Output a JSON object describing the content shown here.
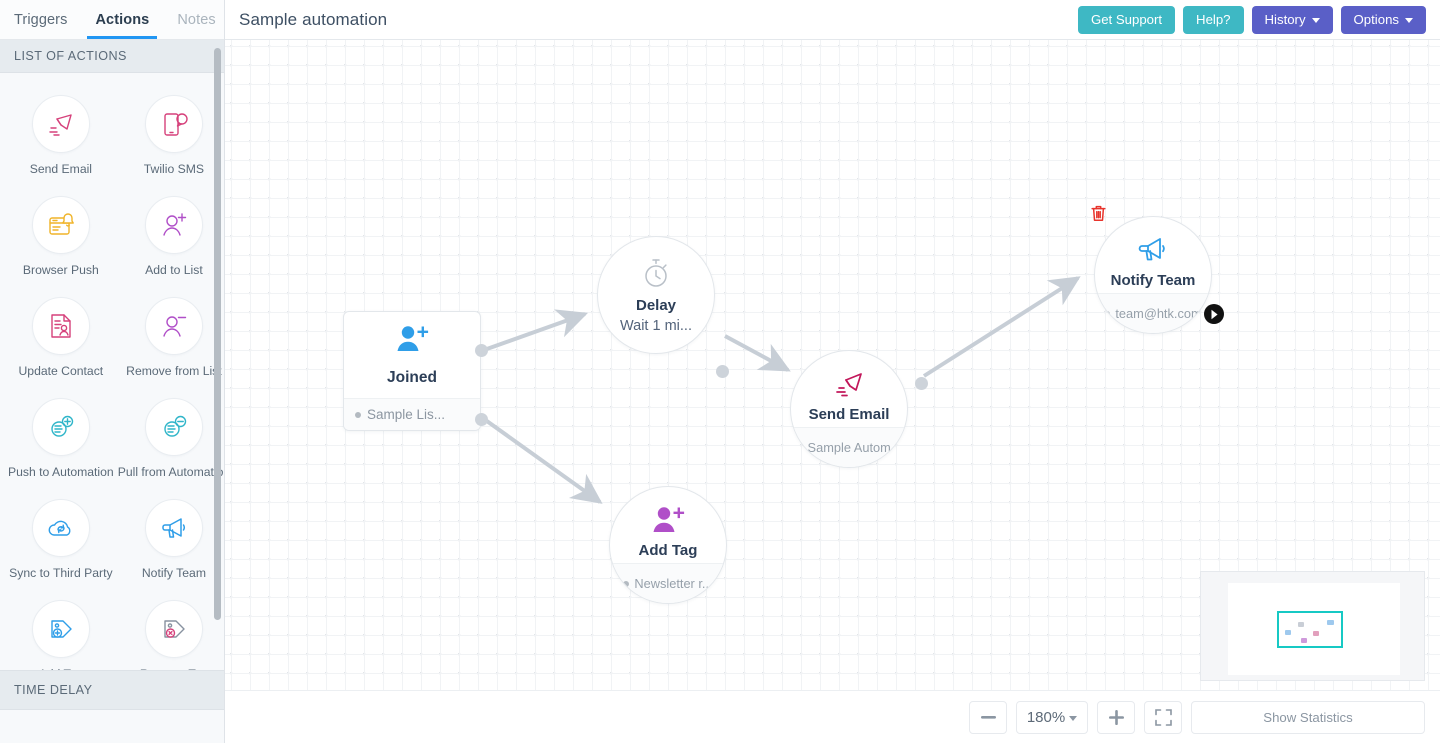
{
  "tabs": [
    {
      "label": "Triggers",
      "active": false,
      "muted": false
    },
    {
      "label": "Actions",
      "active": true,
      "muted": false
    },
    {
      "label": "Notes",
      "active": false,
      "muted": true
    }
  ],
  "sidebar": {
    "section_title": "LIST OF ACTIONS",
    "time_delay_title": "TIME DELAY",
    "actions": [
      {
        "label": "Send Email",
        "icon": "envelope-send-icon",
        "color": "#d6417b"
      },
      {
        "label": "Twilio SMS",
        "icon": "phone-sms-icon",
        "color": "#d6417b"
      },
      {
        "label": "Browser Push",
        "icon": "browser-bell-icon",
        "color": "#f0b429"
      },
      {
        "label": "Add to List",
        "icon": "person-plus-icon",
        "color": "#b04fc8"
      },
      {
        "label": "Update Contact",
        "icon": "document-person-icon",
        "color": "#d6417b"
      },
      {
        "label": "Remove from List",
        "icon": "person-minus-icon",
        "color": "#b04fc8"
      },
      {
        "label": "Push to Automation",
        "icon": "automation-plus-icon",
        "color": "#2fb5c9"
      },
      {
        "label": "Pull from Automation",
        "icon": "automation-minus-icon",
        "color": "#2fb5c9"
      },
      {
        "label": "Sync to Third Party",
        "icon": "cloud-sync-icon",
        "color": "#2f9ee8"
      },
      {
        "label": "Notify Team",
        "icon": "megaphone-icon",
        "color": "#2f9ee8"
      },
      {
        "label": "Add Tag",
        "icon": "tag-plus-icon",
        "color": "#2f9ee8"
      },
      {
        "label": "Remove Tag",
        "icon": "tag-remove-icon",
        "color": "#d6417b"
      }
    ]
  },
  "header": {
    "title": "Sample automation",
    "buttons": [
      {
        "label": "Get Support",
        "style": "teal",
        "caret": false
      },
      {
        "label": "Help?",
        "style": "teal",
        "caret": false
      },
      {
        "label": "History",
        "style": "indigo",
        "caret": true
      },
      {
        "label": "Options",
        "style": "indigo",
        "caret": true
      }
    ]
  },
  "canvas": {
    "nodes": [
      {
        "id": "joined",
        "shape": "rect",
        "title": "Joined",
        "subtitle": "Sample Lis...",
        "icon": "person-plus-icon",
        "color": "#2f9ee8",
        "selected": false
      },
      {
        "id": "delay",
        "shape": "circle",
        "title": "Delay",
        "subtitle": "Wait  1 mi...",
        "icon": "stopwatch-icon",
        "color": "#b9c0c8",
        "selected": false
      },
      {
        "id": "send-email",
        "shape": "circle",
        "title": "Send Email",
        "subtitle": "Sample Autom...",
        "icon": "envelope-send-icon",
        "color": "#c2185b",
        "selected": false
      },
      {
        "id": "add-tag",
        "shape": "circle",
        "title": "Add Tag",
        "subtitle": "Newsletter r...",
        "icon": "person-plus-icon",
        "color": "#b04fc8",
        "selected": false
      },
      {
        "id": "notify-team",
        "shape": "circle",
        "title": "Notify Team",
        "subtitle": "team@htk.com",
        "icon": "megaphone-icon",
        "color": "#2f9ee8",
        "selected": true
      }
    ]
  },
  "minimap": {
    "label": "canvas-minimap"
  },
  "bottom": {
    "zoom_out": "−",
    "zoom_level": "180%",
    "zoom_in": "+",
    "fit_screen": "fit-screen",
    "show_statistics": "Show Statistics"
  },
  "colors": {
    "accent_blue": "#2196f3",
    "btn_teal": "#3eb8c4",
    "btn_indigo": "#5a5fc7",
    "minimap_viewport": "#17c9c4",
    "trash_red": "#e8342c"
  }
}
